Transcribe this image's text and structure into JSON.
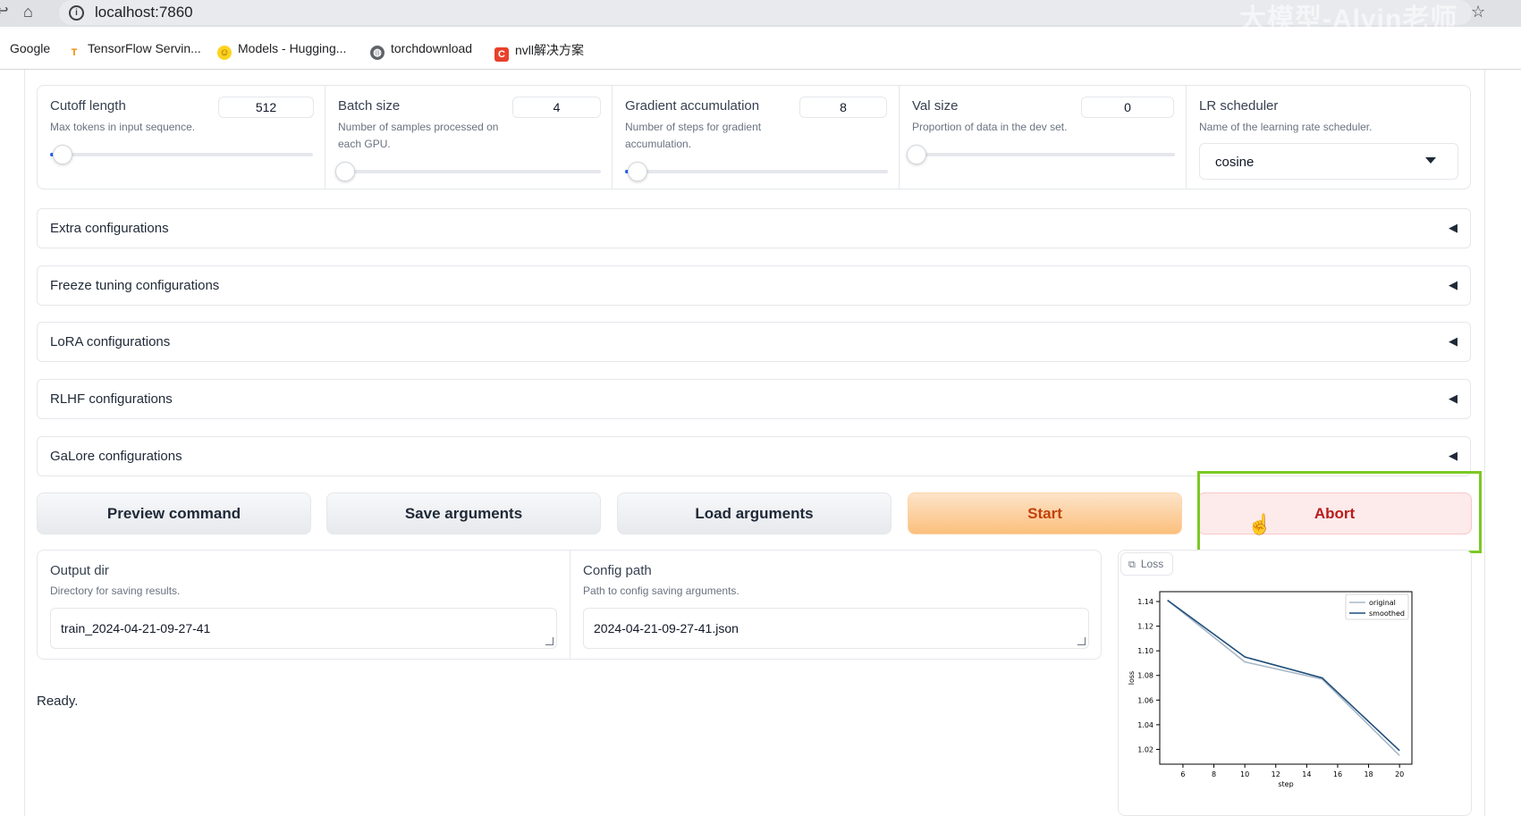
{
  "browser": {
    "url": "localhost:7860",
    "watermark": "大模型-Alvin老师",
    "bookmarks": [
      {
        "label": "Google",
        "icon": "google-icon"
      },
      {
        "label": "TensorFlow Servin...",
        "icon": "tensorflow-icon"
      },
      {
        "label": "Models - Hugging...",
        "icon": "huggingface-icon"
      },
      {
        "label": "torchdownload",
        "icon": "globe-icon"
      },
      {
        "label": "nvll解决方案",
        "icon": "csdn-icon"
      }
    ]
  },
  "params": {
    "cutoff": {
      "label": "Cutoff length",
      "info": "Max tokens in input sequence.",
      "value": "512",
      "level": 0.03
    },
    "batch": {
      "label": "Batch size",
      "info": "Number of samples processed on each GPU.",
      "value": "4",
      "level": 0.01
    },
    "grad_accum": {
      "label": "Gradient accumulation",
      "info": "Number of steps for gradient accumulation.",
      "value": "8",
      "level": 0.03
    },
    "val_size": {
      "label": "Val size",
      "info": "Proportion of data in the dev set.",
      "value": "0",
      "level": 0.0
    },
    "lr_scheduler": {
      "label": "LR scheduler",
      "info": "Name of the learning rate scheduler.",
      "value": "cosine"
    }
  },
  "accordions": [
    "Extra configurations",
    "Freeze tuning configurations",
    "LoRA configurations",
    "RLHF configurations",
    "GaLore configurations"
  ],
  "buttons": {
    "preview": "Preview command",
    "save": "Save arguments",
    "load": "Load arguments",
    "start": "Start",
    "abort": "Abort"
  },
  "output": {
    "label": "Output dir",
    "info": "Directory for saving results.",
    "value": "train_2024-04-21-09-27-41"
  },
  "config": {
    "label": "Config path",
    "info": "Path to config saving arguments.",
    "value": "2024-04-21-09-27-41.json"
  },
  "status": "Ready.",
  "plot": {
    "tab_label": "Loss"
  },
  "chart_data": {
    "type": "line",
    "title": "",
    "xlabel": "step",
    "ylabel": "loss",
    "xlim": [
      4.5,
      20.8
    ],
    "ylim": [
      1.008,
      1.148
    ],
    "xticks": [
      6,
      8,
      10,
      12,
      14,
      16,
      18,
      20
    ],
    "yticks": [
      1.02,
      1.04,
      1.06,
      1.08,
      1.1,
      1.12,
      1.14
    ],
    "legend_position": "top-right",
    "series": [
      {
        "name": "original",
        "color": "#a8b8c8",
        "x": [
          5,
          10,
          15,
          20
        ],
        "y": [
          1.141,
          1.091,
          1.077,
          1.015
        ]
      },
      {
        "name": "smoothed",
        "color": "#1f4e79",
        "x": [
          5,
          10,
          15,
          20
        ],
        "y": [
          1.141,
          1.095,
          1.078,
          1.019
        ]
      }
    ]
  }
}
